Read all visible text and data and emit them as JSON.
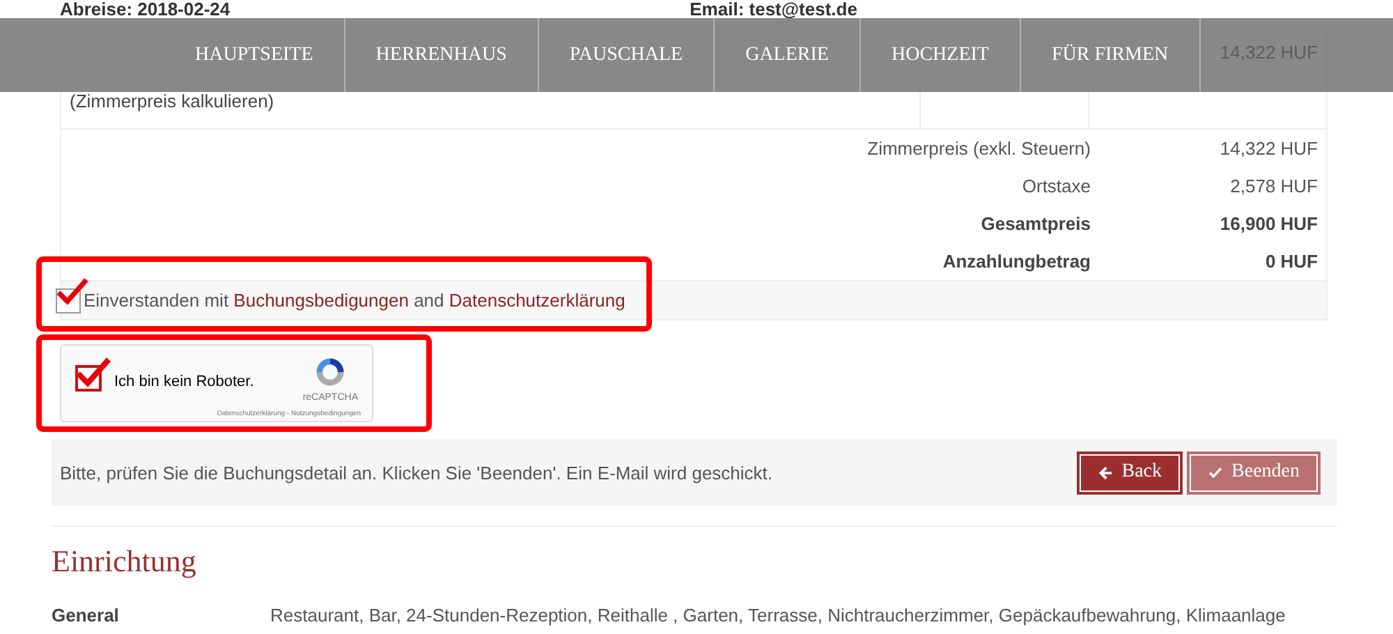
{
  "header": {
    "departure": "Abreise: 2018-02-24",
    "email": "Email: test@test.de"
  },
  "nav": [
    {
      "label": "HAUPTSEITE"
    },
    {
      "label": "HERRENHAUS"
    },
    {
      "label": "PAUSCHALE"
    },
    {
      "label": "GALERIE"
    },
    {
      "label": "HOCHZEIT"
    },
    {
      "label": "FÜR FIRMEN"
    }
  ],
  "room": {
    "calc_link": "(Zimmerpreis kalkulieren)",
    "price": "14,322 HUF"
  },
  "summary": [
    {
      "label": "Zimmerpreis (exkl. Steuern)",
      "value": "14,322 HUF",
      "bold": false
    },
    {
      "label": "Ortstaxe",
      "value": "2,578 HUF",
      "bold": false
    },
    {
      "label": "Gesamtpreis",
      "value": "16,900 HUF",
      "bold": true
    },
    {
      "label": "Anzahlungbetrag",
      "value": "0 HUF",
      "bold": true
    }
  ],
  "consent": {
    "checked": true,
    "text": "Einverstanden mit",
    "link_1": "Buchungsbedigungen",
    "joiner": "and",
    "link_2": "Datenschutzerklärung"
  },
  "captcha": {
    "checked": true,
    "label": "Ich bin kein Roboter.",
    "brand": "reCAPTCHA",
    "links": "Datenschutzerklärung - Nutzungsbedingungen"
  },
  "notice": "Bitte, prüfen Sie die Buchungsdetail an. Klicken Sie 'Beenden'. Ein E-Mail wird geschickt.",
  "buttons": [
    {
      "kind": "back",
      "label": "Back",
      "disabled": false
    },
    {
      "kind": "finish",
      "label": "Beenden",
      "disabled": true
    }
  ],
  "facilities": {
    "heading": "Einrichtung",
    "rows": [
      {
        "label": "General",
        "value": "Restaurant, Bar, 24-Stunden-Rezeption, Reithalle , Garten, Terrasse, Nichtraucherzimmer, Gepäckaufbewahrung, Klimaanlage"
      }
    ]
  }
}
